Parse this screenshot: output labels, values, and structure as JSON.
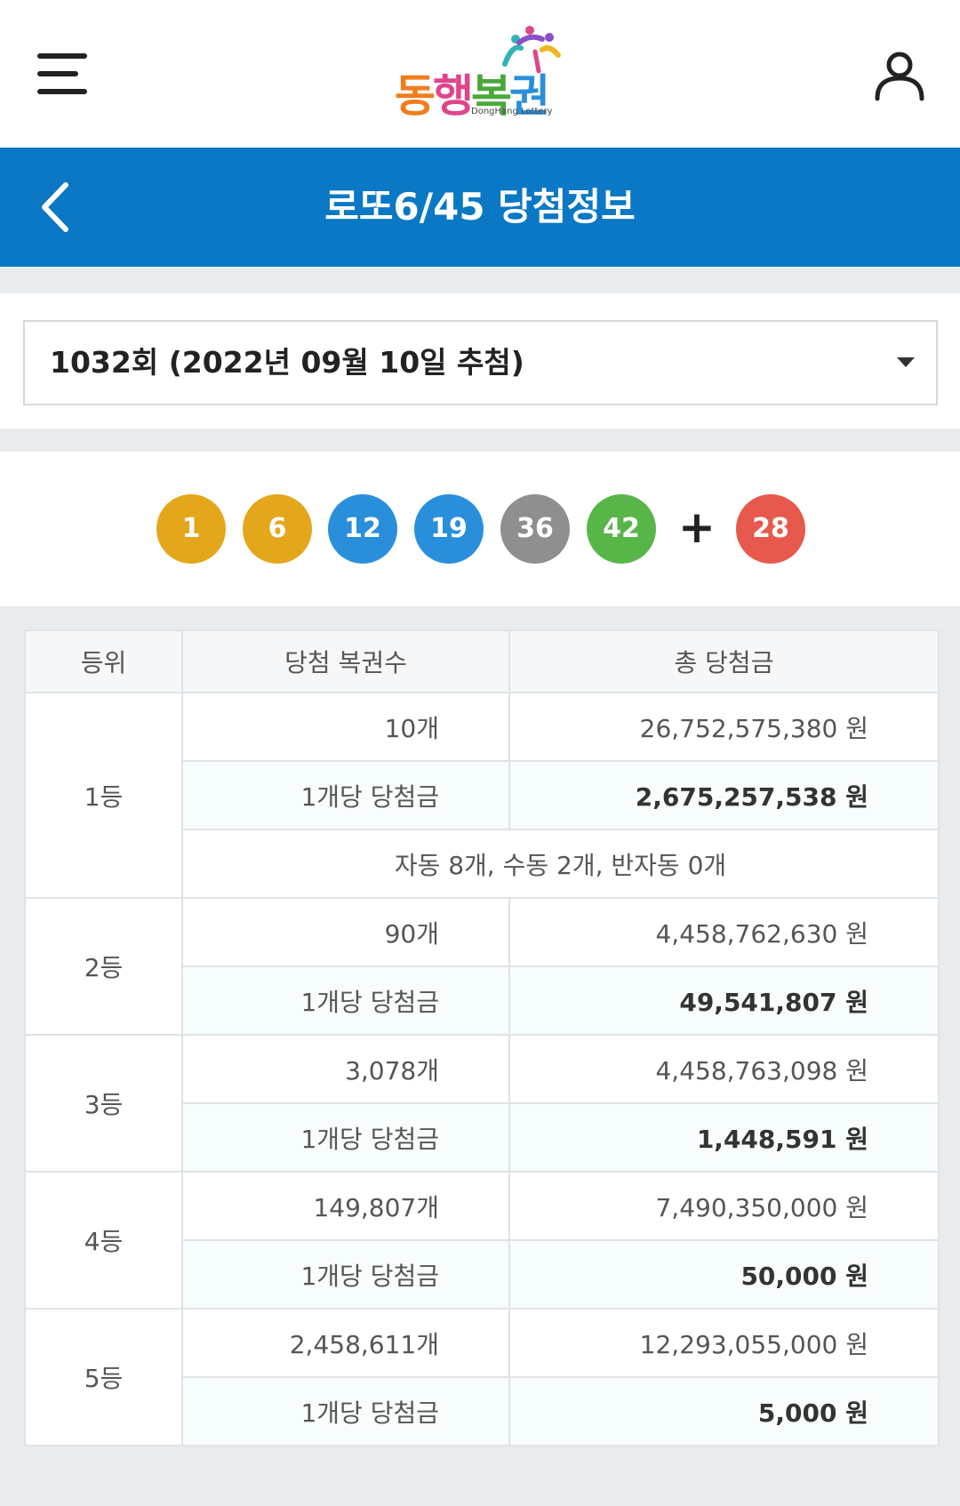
{
  "header": {
    "logo_text": "동행복권",
    "logo_sub": "DongHang Lottery"
  },
  "titlebar": {
    "title": "로또6/45 당첨정보"
  },
  "round_select": {
    "selected": "1032회 (2022년 09월 10일 추첨)"
  },
  "colors": {
    "brand_blue": "#0a78c4",
    "ball_yellow": "#e4a61b",
    "ball_blue": "#2a8fdb",
    "ball_gray": "#8f8f8f",
    "ball_green": "#58b649",
    "ball_red": "#e6594c"
  },
  "winning_numbers": {
    "main": [
      "1",
      "6",
      "12",
      "19",
      "36",
      "42"
    ],
    "plus_sign": "+",
    "bonus": "28"
  },
  "prize_table": {
    "headers": [
      "등위",
      "당첨 복권수",
      "총 당첨금"
    ],
    "per_label": "1개당 당첨금",
    "rows": [
      {
        "rank": "1등",
        "count": "10개",
        "total": "26,752,575,380 원",
        "per_game": "2,675,257,538 원",
        "note": "자동 8개, 수동 2개, 반자동 0개"
      },
      {
        "rank": "2등",
        "count": "90개",
        "total": "4,458,762,630 원",
        "per_game": "49,541,807 원"
      },
      {
        "rank": "3등",
        "count": "3,078개",
        "total": "4,458,763,098 원",
        "per_game": "1,448,591 원"
      },
      {
        "rank": "4등",
        "count": "149,807개",
        "total": "7,490,350,000 원",
        "per_game": "50,000 원"
      },
      {
        "rank": "5등",
        "count": "2,458,611개",
        "total": "12,293,055,000 원",
        "per_game": "5,000 원"
      }
    ]
  }
}
